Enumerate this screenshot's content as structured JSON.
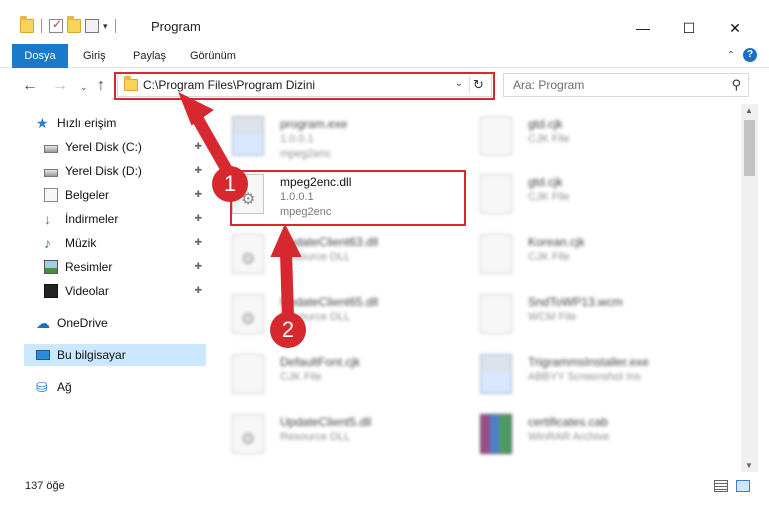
{
  "window": {
    "title": "Program",
    "minimize": "—",
    "maximize": "☐",
    "close": "✕"
  },
  "ribbon": {
    "tabs": [
      "Dosya",
      "Giriş",
      "Paylaş",
      "Görünüm"
    ],
    "help": "?",
    "collapse": "⌃"
  },
  "nav": {
    "back": "←",
    "forward": "→",
    "recent": "⌄",
    "up": "↑",
    "address": "C:\\Program Files\\Program Dizini",
    "address_dropdown": "⌄",
    "refresh": "↻",
    "search_placeholder": "Ara: Program",
    "search_icon": "⚲"
  },
  "sidebar": {
    "items": [
      {
        "label": "Hızlı erişim",
        "icon": "star-icon"
      },
      {
        "label": "Yerel Disk (C:)",
        "icon": "drive-icon",
        "pinned": true
      },
      {
        "label": "Yerel Disk (D:)",
        "icon": "drive-icon",
        "pinned": true
      },
      {
        "label": "Belgeler",
        "icon": "documents-icon",
        "pinned": true
      },
      {
        "label": "İndirmeler",
        "icon": "downloads-icon",
        "pinned": true
      },
      {
        "label": "Müzik",
        "icon": "music-icon",
        "pinned": true
      },
      {
        "label": "Resimler",
        "icon": "pictures-icon",
        "pinned": true
      },
      {
        "label": "Videolar",
        "icon": "videos-icon",
        "pinned": true
      },
      {
        "label": "OneDrive",
        "icon": "cloud-icon"
      },
      {
        "label": "Bu bilgisayar",
        "icon": "computer-icon",
        "selected": true
      },
      {
        "label": "Ağ",
        "icon": "network-icon"
      }
    ],
    "pin_glyph": "📌"
  },
  "files": [
    {
      "name": "program.exe",
      "line1": "1.0.0.1",
      "line2": "mpeg2enc"
    },
    {
      "name": "gtd.cjk",
      "line1": "CJK File",
      "line2": ""
    },
    {
      "name": "mpeg2enc.dll",
      "line1": "1.0.0.1",
      "line2": "mpeg2enc"
    },
    {
      "name": "gtd.cjk",
      "line1": "CJK File",
      "line2": ""
    },
    {
      "name": "UpdateClient63.dll",
      "line1": "Resource DLL",
      "line2": ""
    },
    {
      "name": "Korean.cjk",
      "line1": "CJK File",
      "line2": ""
    },
    {
      "name": "UpdateClient65.dll",
      "line1": "Resource DLL",
      "line2": ""
    },
    {
      "name": "SndToWP13.wcm",
      "line1": "WCM File",
      "line2": ""
    },
    {
      "name": "DefaultFont.cjk",
      "line1": "CJK File",
      "line2": ""
    },
    {
      "name": "TrigrammsInstaller.exe",
      "line1": "ABBYY Screenshot Ins",
      "line2": ""
    },
    {
      "name": "UpdateClient5.dll",
      "line1": "Resource DLL",
      "line2": ""
    },
    {
      "name": "certificates.cab",
      "line1": "WinRAR Archive",
      "line2": ""
    }
  ],
  "status": {
    "count": "137 öğe"
  },
  "annotations": {
    "step1": "1",
    "step2": "2",
    "color": "#d6282e"
  }
}
